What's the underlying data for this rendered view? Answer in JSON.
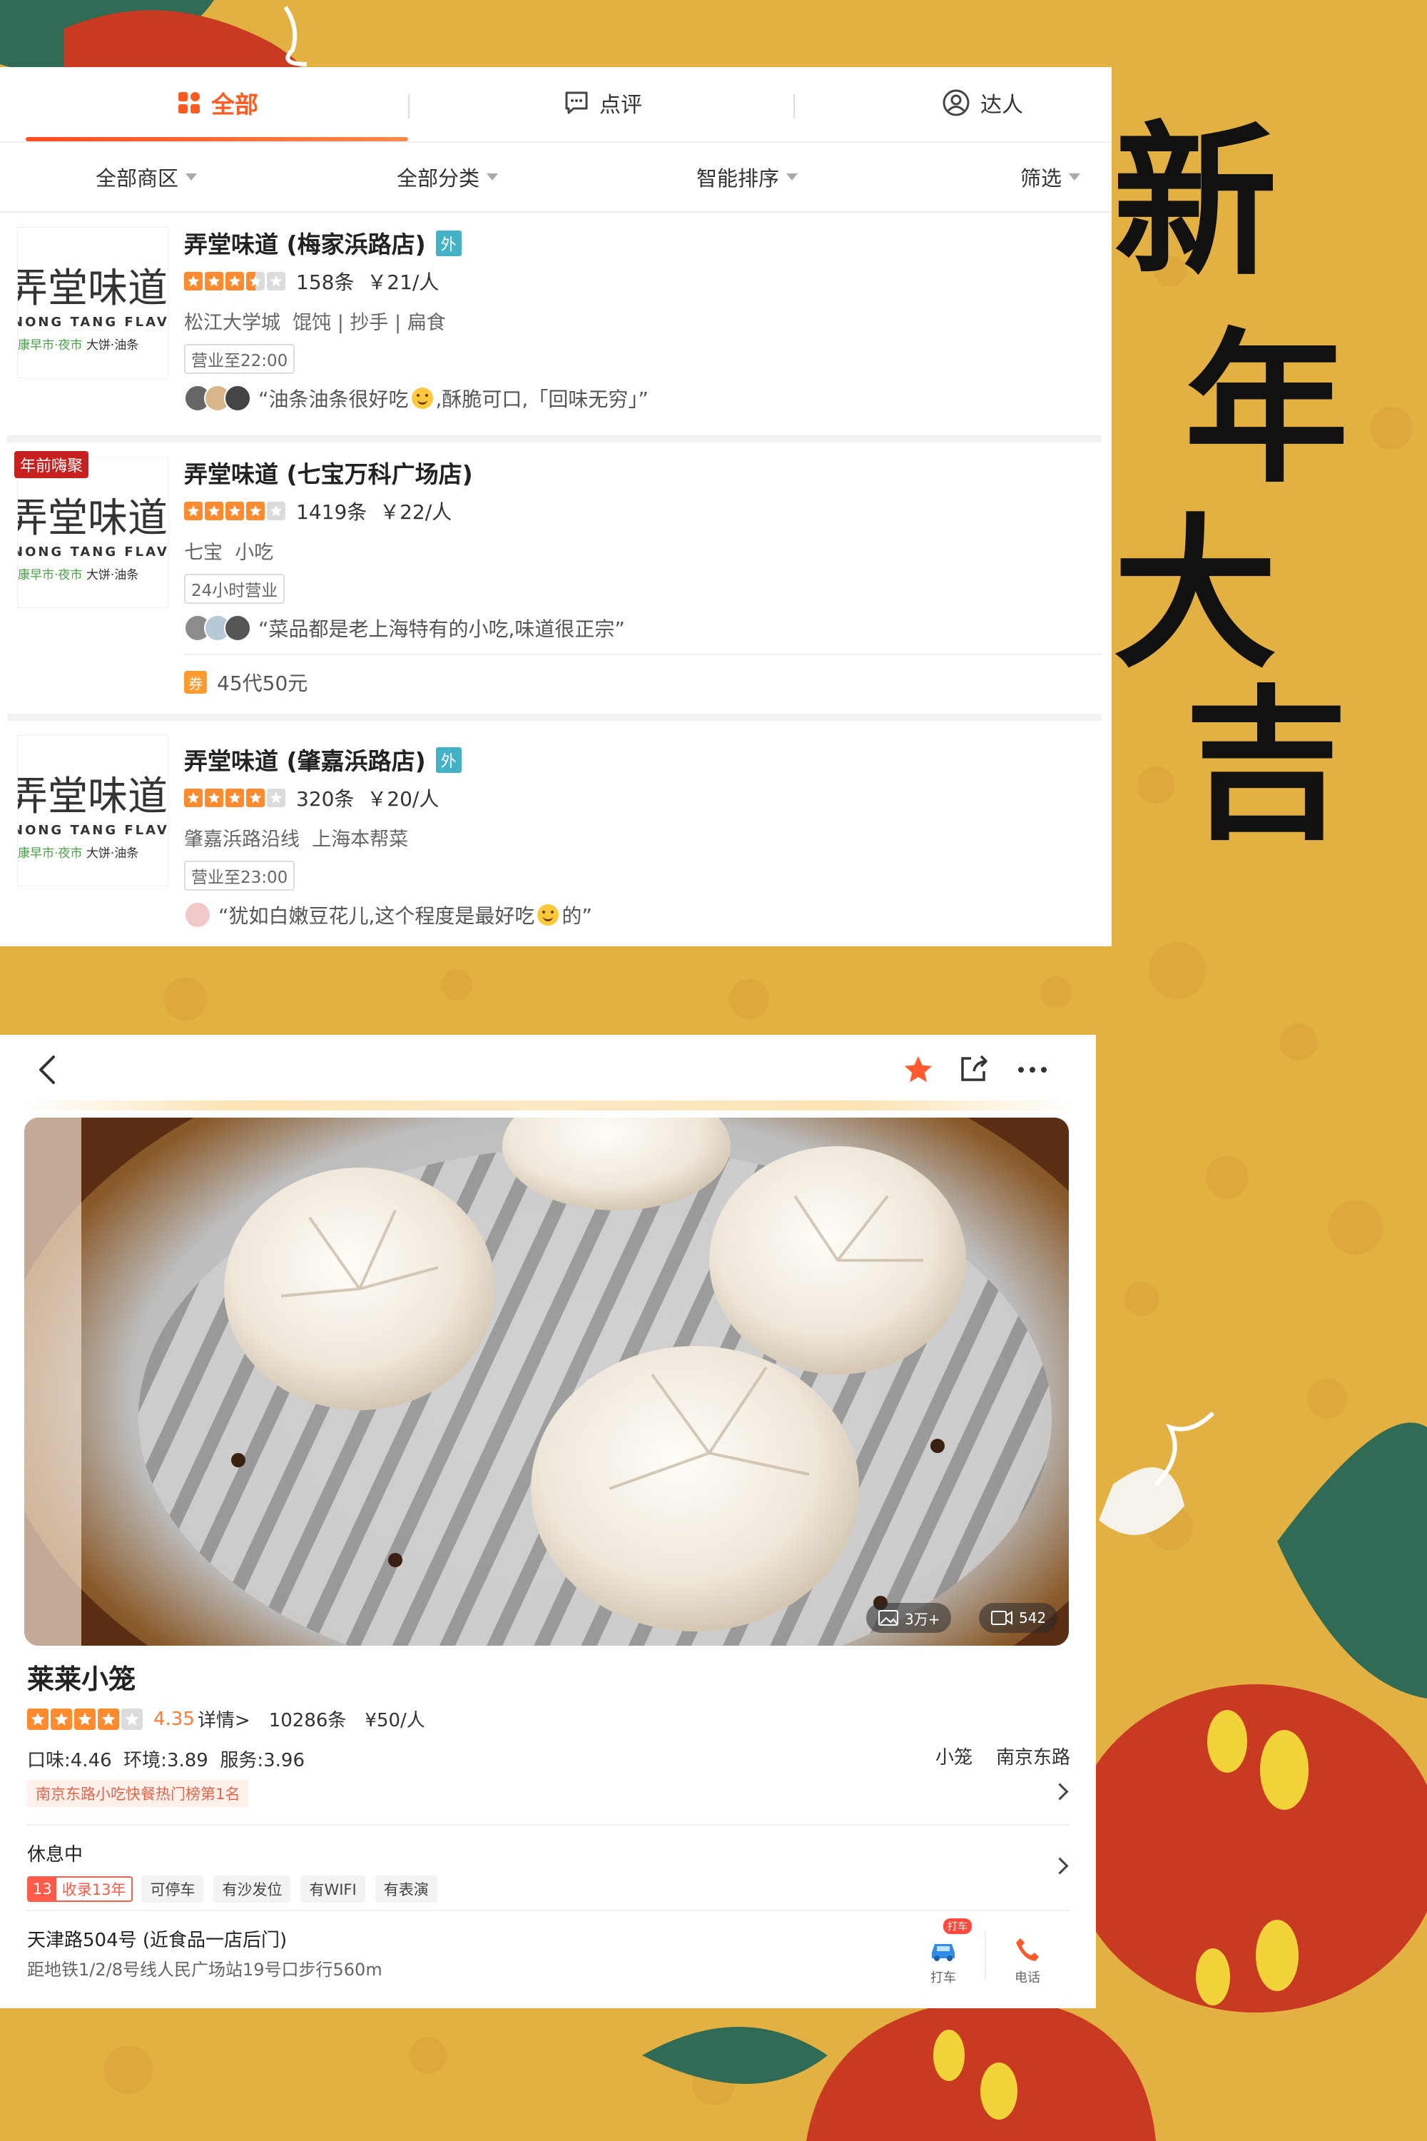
{
  "festive_text": [
    "新",
    "年",
    "大",
    "吉"
  ],
  "tabs": [
    {
      "label": "全部",
      "active": true,
      "icon": "grid-icon"
    },
    {
      "label": "点评",
      "active": false,
      "icon": "comment-icon"
    },
    {
      "label": "达人",
      "active": false,
      "icon": "user-icon"
    }
  ],
  "filters": [
    {
      "label": "全部商区"
    },
    {
      "label": "全部分类"
    },
    {
      "label": "智能排序"
    },
    {
      "label": "筛选"
    }
  ],
  "logo": {
    "main": "弄堂味道",
    "english": "NONG TANG FLAVOR",
    "sub_green": "康早市·夜市",
    "sub_dark": "大饼·油条"
  },
  "shops": [
    {
      "name": "弄堂味道 (梅家浜路店)",
      "tag": "外",
      "stars": 3.5,
      "reviews": "158条",
      "price": "￥21/人",
      "categories": "松江大学城  馄饨 | 抄手 | 扁食",
      "hours": "营业至22:00",
      "review_before": "“油条油条很好吃",
      "review_after": ",酥脆可口,「回味无穷」”",
      "promo": ""
    },
    {
      "name": "弄堂味道 (七宝万科广场店)",
      "tag": "",
      "stars": 4,
      "reviews": "1419条",
      "price": "￥22/人",
      "categories": "七宝  小吃",
      "hours": "24小时营业",
      "review_before": "“菜品都是老上海特有的小吃,味道很正宗”",
      "review_after": "",
      "promo": "年前嗨聚",
      "coupon_icon": "券",
      "coupon": "45代50元"
    },
    {
      "name": "弄堂味道 (肇嘉浜路店)",
      "tag": "外",
      "stars": 4,
      "reviews": "320条",
      "price": "￥20/人",
      "categories": "肇嘉浜路沿线  上海本帮菜",
      "hours": "营业至23:00",
      "review_before": "“犹如白嫩豆花儿,这个程度是最好吃",
      "review_after": "的”",
      "promo": ""
    }
  ],
  "detail": {
    "photo_count": "3万+",
    "video_count": "542",
    "name": "莱莱小笼",
    "stars": 4,
    "score": "4.35",
    "score_link": "详情>",
    "reviews": "10286条",
    "price": "¥50/人",
    "sub_scores": "口味:4.46  环境:3.89  服务:3.96",
    "tags_right": "小笼    南京东路",
    "rank": "南京东路小吃快餐热门榜第1名",
    "status": "休息中",
    "years_num": "13",
    "years_text": "收录13年",
    "facilities": [
      "可停车",
      "有沙发位",
      "有WIFI",
      "有表演"
    ],
    "address": "天津路504号 (近食品一店后门)",
    "distance": "距地铁1/2/8号线人民广场站19号口步行560m",
    "action_taxi": "打车",
    "action_taxi_badge": "打车",
    "action_phone": "电话"
  },
  "colors": {
    "background": "#e3b042",
    "accent": "#ff5a1f",
    "star": "#ff8b2e",
    "favorite": "#ff5a2e"
  }
}
